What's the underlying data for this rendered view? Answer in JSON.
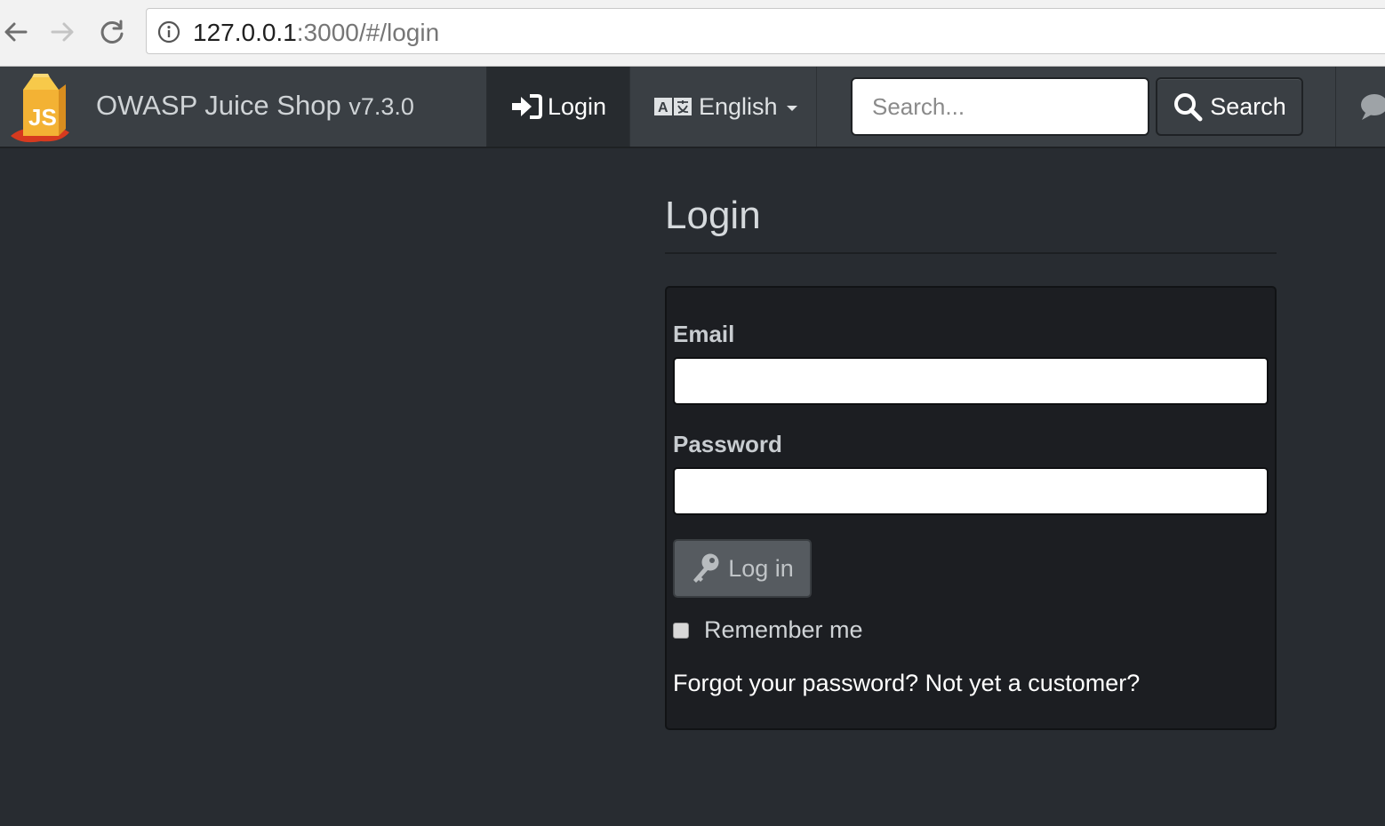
{
  "browser": {
    "url_host": "127.0.0.1",
    "url_rest": ":3000/#/login",
    "icons": [
      "back-arrow-icon",
      "forward-arrow-icon",
      "reload-icon",
      "info-icon"
    ]
  },
  "navbar": {
    "brand_name": "OWASP Juice Shop",
    "brand_version": "v7.3.0",
    "login_label": "Login",
    "language_label": "English",
    "search_placeholder": "Search...",
    "search_button_label": "Search",
    "icons": [
      "juice-box-logo",
      "sign-in-icon",
      "language-icon",
      "caret-down-icon",
      "search-icon",
      "chat-icon"
    ]
  },
  "login_page": {
    "title": "Login",
    "email_label": "Email",
    "email_value": "",
    "password_label": "Password",
    "password_value": "",
    "login_button_label": "Log in",
    "remember_label": "Remember me",
    "remember_checked": false,
    "forgot_link": "Forgot your password?",
    "register_link": "Not yet a customer?",
    "icons": [
      "key-icon"
    ]
  },
  "colors": {
    "page_background": "#282c31",
    "navbar_background": "#3a3f44",
    "panel_background": "#1c1e22",
    "text_light": "#d5d9dc"
  }
}
